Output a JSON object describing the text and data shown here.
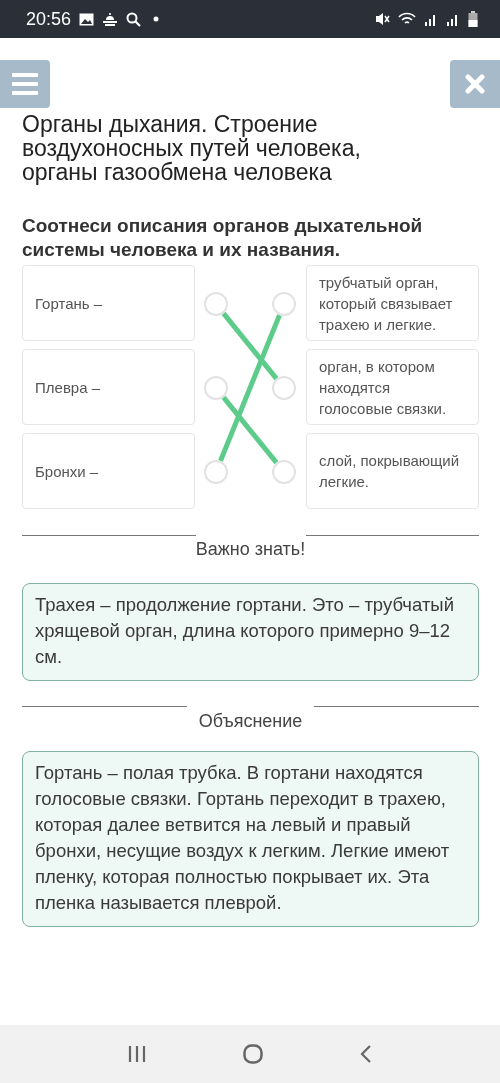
{
  "status_bar": {
    "time": "20:56"
  },
  "title": "Органы дыхания. Строение воздухоносных путей человека, органы газообмена человека",
  "task": "Соотнеси описания органов дыхательной системы человека и их названия.",
  "matching": {
    "left": [
      {
        "label": "Гортань –",
        "linked_to_right": [
          false,
          true,
          false
        ]
      },
      {
        "label": "Плевра –",
        "linked_to_right": [
          false,
          false,
          true
        ]
      },
      {
        "label": "Бронхи –",
        "linked_to_right": [
          true,
          false,
          false
        ]
      }
    ],
    "right": [
      {
        "label": "трубчатый орган, который связывает трахею и легкие."
      },
      {
        "label": "орган, в котором находятся голосовые связки."
      },
      {
        "label": "слой, покрывающий легкие."
      }
    ]
  },
  "important": {
    "heading": "Важно знать!",
    "text": "Трахея – продолжение гортани. Это – трубчатый хрящевой орган, длина которого примерно 9–12 см."
  },
  "explanation": {
    "heading": "Объяснение",
    "text": "Гортань – полая трубка. В гортани находятся голосовые связки. Гортань переходит в трахею, которая далее ветвится на левый и правый бронхи, несущие воздух к легким. Легкие имеют пленку, которая полностью покрывает их. Эта пленка называется плеврой."
  }
}
